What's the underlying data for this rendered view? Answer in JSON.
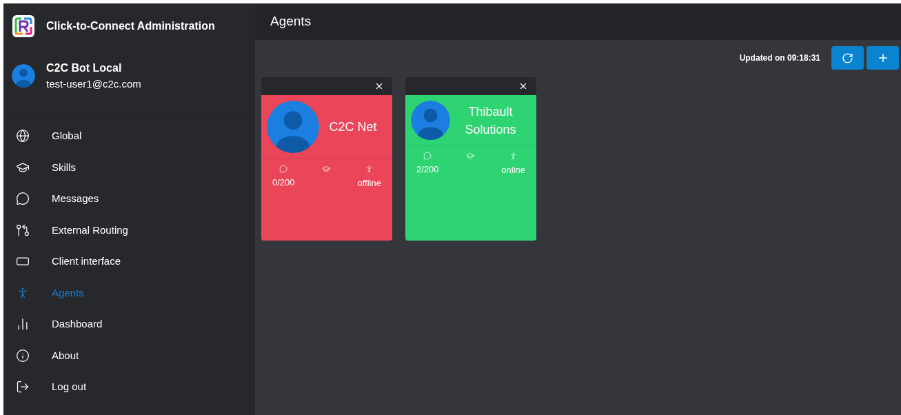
{
  "app": {
    "title": "Click-to-Connect Administration"
  },
  "user": {
    "name": "C2C Bot Local",
    "email": "test-user1@c2c.com"
  },
  "nav": [
    {
      "kind": "globe",
      "label": "Global",
      "selected": false
    },
    {
      "kind": "skills",
      "label": "Skills",
      "selected": false
    },
    {
      "kind": "messages",
      "label": "Messages",
      "selected": false
    },
    {
      "kind": "routing",
      "label": "External Routing",
      "selected": false
    },
    {
      "kind": "client",
      "label": "Client interface",
      "selected": false
    },
    {
      "kind": "agents",
      "label": "Agents",
      "selected": true
    },
    {
      "kind": "dashboard",
      "label": "Dashboard",
      "selected": false
    },
    {
      "kind": "about",
      "label": "About",
      "selected": false
    },
    {
      "kind": "logout",
      "label": "Log out",
      "selected": false
    }
  ],
  "page": {
    "title": "Agents",
    "updated": "Updated on 09:18:31"
  },
  "agents": [
    {
      "name": "C2C Net",
      "color": "#ea4559",
      "conversations": "0/200",
      "status": "offline"
    },
    {
      "name": "Thibault Solutions",
      "color": "#2ed472",
      "conversations": "2/200",
      "status": "online"
    }
  ]
}
